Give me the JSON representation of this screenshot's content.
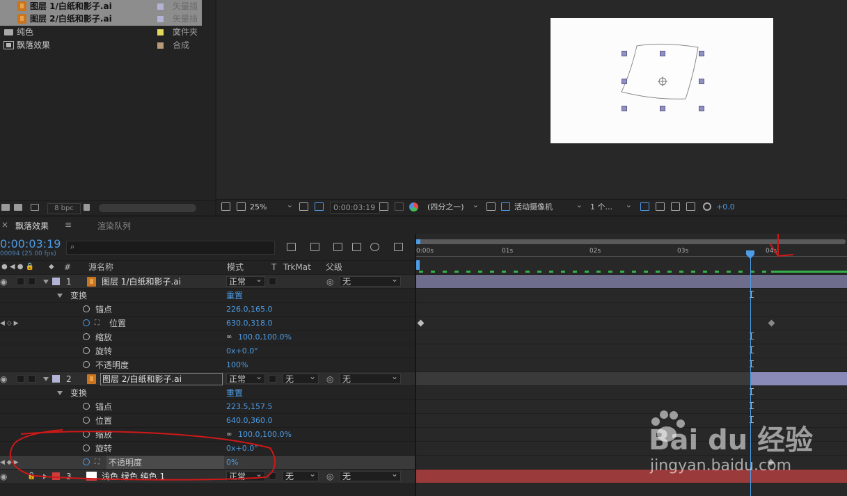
{
  "project": {
    "items": [
      {
        "name": "图层 1/白纸和影子.ai",
        "type": "矢量插画",
        "label_color": "#b3b3d6",
        "icon": "illustrator-file-icon",
        "selected": true
      },
      {
        "name": "图层 2/白纸和影子.ai",
        "type": "矢量插画",
        "label_color": "#b3b3d6",
        "icon": "illustrator-file-icon",
        "selected": true
      },
      {
        "name": "纯色",
        "type": "文件夹",
        "label_color": "#e5d65c",
        "icon": "folder-icon",
        "selected": false
      },
      {
        "name": "飘落效果",
        "type": "合成",
        "label_color": "#b89a78",
        "icon": "composition-icon",
        "selected": false
      }
    ],
    "bpc": "8 bpc"
  },
  "viewer": {
    "zoom": "25%",
    "timecode": "0:00:03:19",
    "resolution": "(四分之一)",
    "camera": "活动摄像机",
    "views": "1 个...",
    "exposure": "+0.0"
  },
  "timeline": {
    "tabs": {
      "comp": "飘落效果",
      "render_queue": "渲染队列"
    },
    "timecode": "0:00:03:19",
    "frame_info": "00094 (25.00 fps)",
    "search_placeholder": "",
    "columns": {
      "number": "#",
      "source_name": "源名称",
      "mode": "模式",
      "t": "T",
      "trkmat": "TrkMat",
      "parent": "父级"
    },
    "ruler": [
      "0:00s",
      "01s",
      "02s",
      "03s",
      "04s"
    ],
    "rows": {
      "layer1": {
        "num": "1",
        "name": "图层 1/白纸和影子.ai",
        "mode": "正常",
        "parent": "无"
      },
      "transform1": {
        "label": "变换",
        "reset": "重置"
      },
      "anchor1": {
        "label": "锚点",
        "value": "226.0,165.0"
      },
      "position1": {
        "label": "位置",
        "value": "630.0,318.0"
      },
      "scale1": {
        "label": "缩放",
        "value": "100.0,100.0%"
      },
      "rotation1": {
        "label": "旋转",
        "value": "0x+0.0°"
      },
      "opacity1": {
        "label": "不透明度",
        "value": "100%"
      },
      "layer2": {
        "num": "2",
        "name": "图层 2/白纸和影子.ai",
        "mode": "正常",
        "trkmat": "无",
        "parent": "无"
      },
      "transform2": {
        "label": "变换",
        "reset": "重置"
      },
      "anchor2": {
        "label": "锚点",
        "value": "223.5,157.5"
      },
      "position2": {
        "label": "位置",
        "value": "640.0,360.0"
      },
      "scale2": {
        "label": "缩放",
        "value": "100.0,100.0%"
      },
      "rotation2": {
        "label": "旋转",
        "value": "0x+0.0°"
      },
      "opacity2": {
        "label": "不透明度",
        "value": "0%"
      },
      "layer3": {
        "num": "3",
        "name": "浅色 绿色 纯色 1",
        "mode": "正常",
        "trkmat": "无",
        "parent": "无"
      }
    }
  },
  "watermark": {
    "brand": "Bai du 经验",
    "url": "jingyan.baidu.com"
  }
}
